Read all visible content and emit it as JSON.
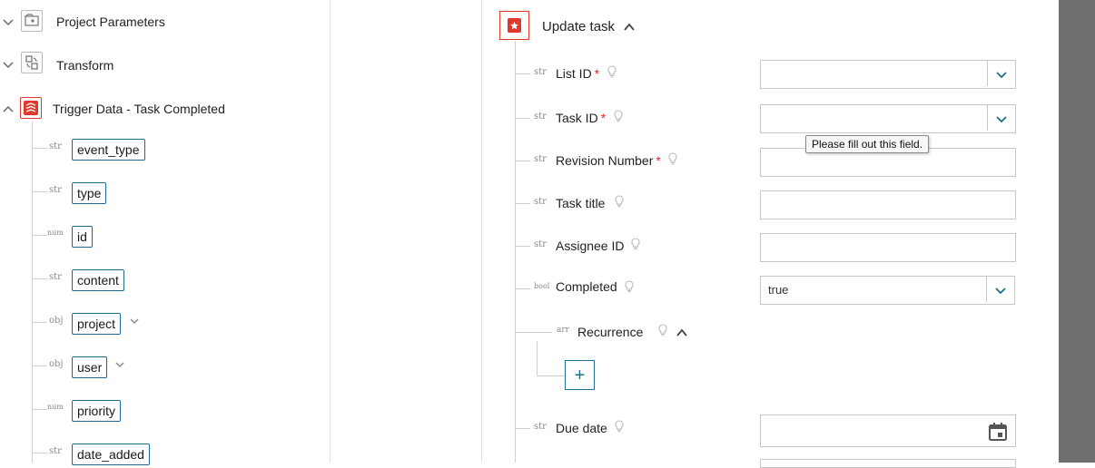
{
  "colors": {
    "accent": "#1e6b8f",
    "required": "#d9262a",
    "brand": "#e0392b"
  },
  "tree": {
    "nodes": [
      {
        "label": "Project Parameters",
        "icon": "project-parameters-icon",
        "expanded": false
      },
      {
        "label": "Transform",
        "icon": "transform-icon",
        "expanded": false
      },
      {
        "label": "Trigger Data - Task Completed",
        "icon": "todoist-icon",
        "expanded": true
      }
    ],
    "fields": [
      {
        "type": "str",
        "name": "event_type"
      },
      {
        "type": "str",
        "name": "type"
      },
      {
        "type": "num",
        "name": "id"
      },
      {
        "type": "str",
        "name": "content"
      },
      {
        "type": "obj",
        "name": "project"
      },
      {
        "type": "obj",
        "name": "user"
      },
      {
        "type": "num",
        "name": "priority"
      },
      {
        "type": "str",
        "name": "date_added"
      }
    ]
  },
  "form": {
    "title": "Update task",
    "fields": [
      {
        "type": "str",
        "label": "List ID",
        "required": "*",
        "value": ""
      },
      {
        "type": "str",
        "label": "Task ID",
        "required": "*",
        "value": ""
      },
      {
        "type": "str",
        "label": "Revision Number",
        "required": "*",
        "value": ""
      },
      {
        "type": "str",
        "label": "Task title",
        "value": ""
      },
      {
        "type": "str",
        "label": "Assignee ID",
        "value": ""
      },
      {
        "type": "bool",
        "label": "Completed",
        "value": "true"
      },
      {
        "type": "arr",
        "label": "Recurrence"
      },
      {
        "type": "str",
        "label": "Due date",
        "value": ""
      }
    ],
    "tooltip": "Please fill out this field.",
    "add_label": "+"
  }
}
